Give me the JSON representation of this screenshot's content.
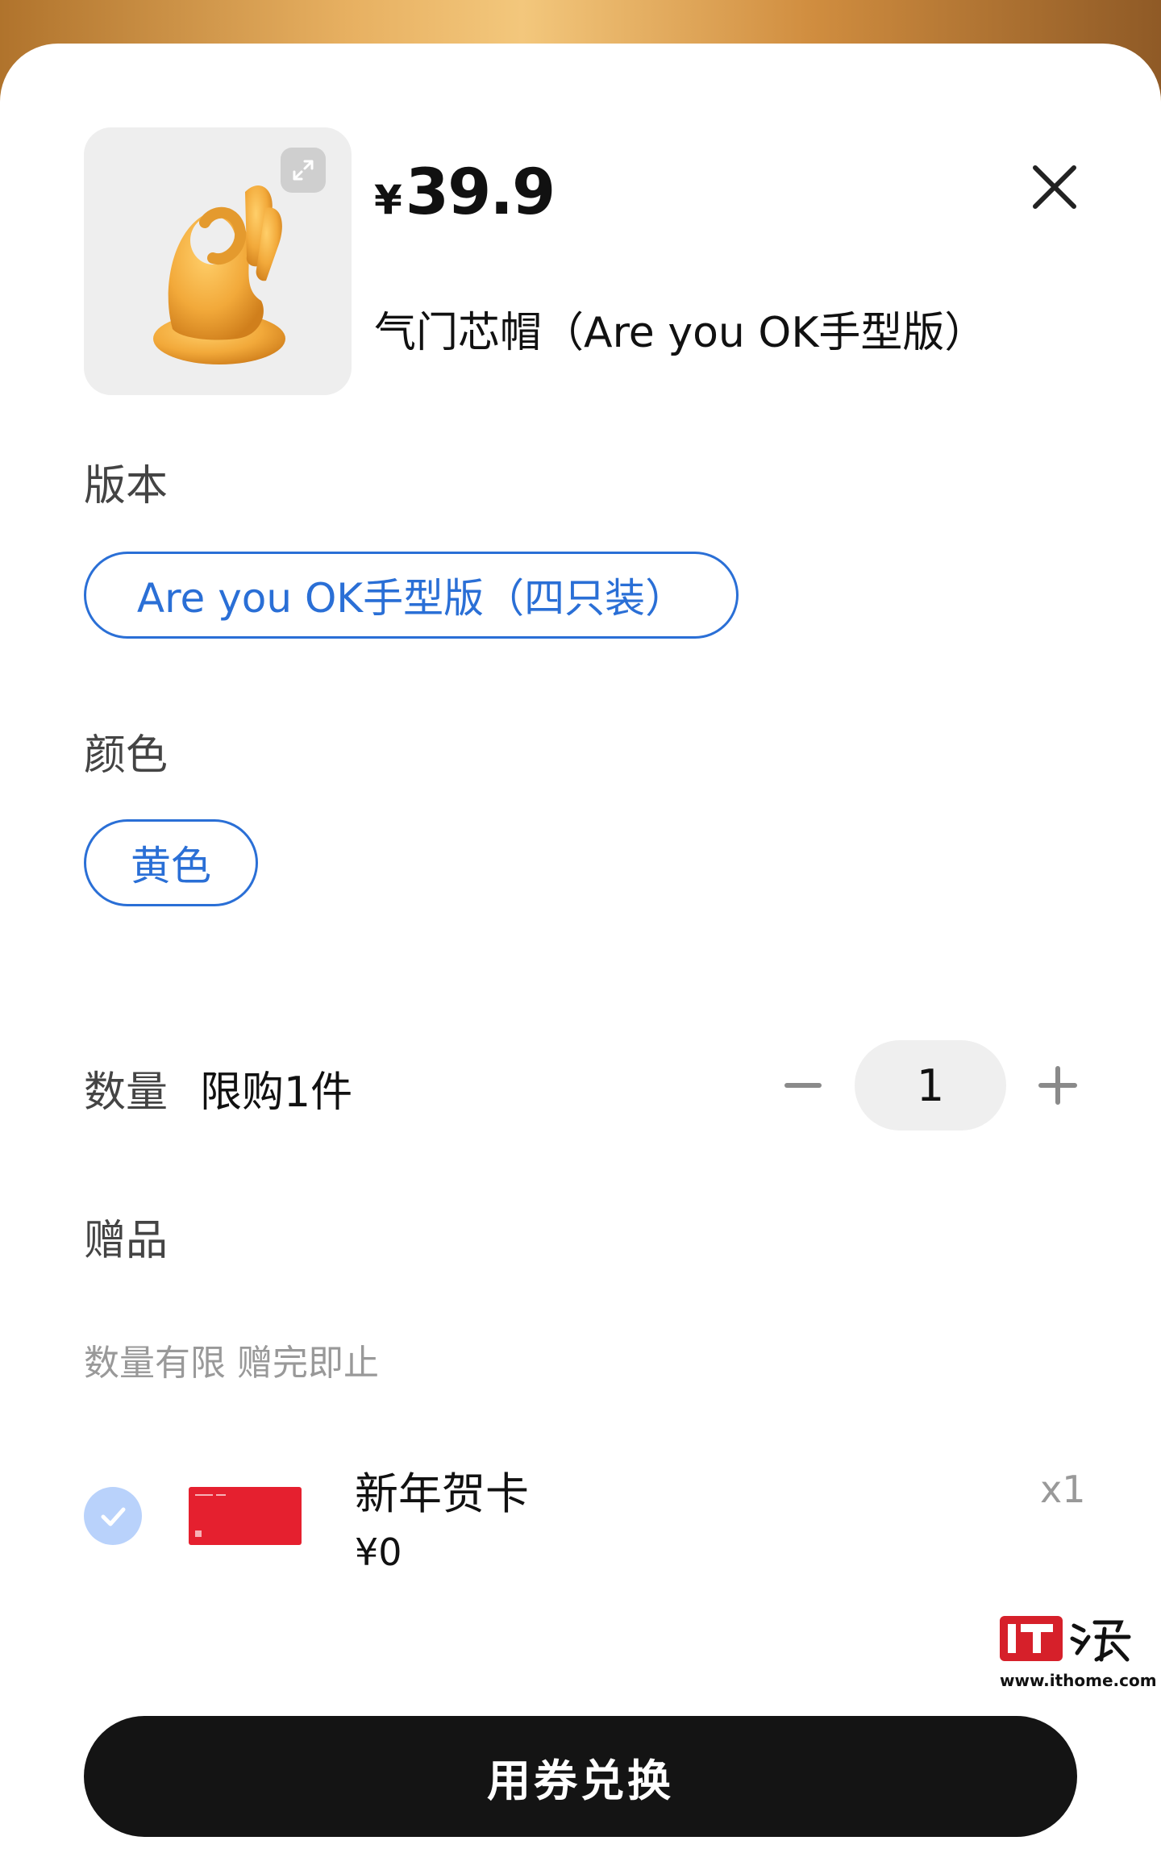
{
  "product": {
    "currency": "¥",
    "price": "39.9",
    "title": "气门芯帽（Are you OK手型版）"
  },
  "version": {
    "label": "版本",
    "selected": "Are you OK手型版（四只装）"
  },
  "color": {
    "label": "颜色",
    "selected": "黄色"
  },
  "quantity": {
    "label": "数量",
    "limit": "限购1件",
    "value": "1"
  },
  "gift": {
    "label": "赠品",
    "hint": "数量有限 赠完即止",
    "item_name": "新年贺卡",
    "item_price": "¥0",
    "item_qty": "x1",
    "checked": true
  },
  "watermark": {
    "url": "www.ithome.com"
  },
  "cta": {
    "label": "用券兑换"
  },
  "colors": {
    "accent": "#2a6fd6",
    "product_yellow": "#f2a93a",
    "card_red": "#e5202f",
    "button_dark": "#141414"
  }
}
